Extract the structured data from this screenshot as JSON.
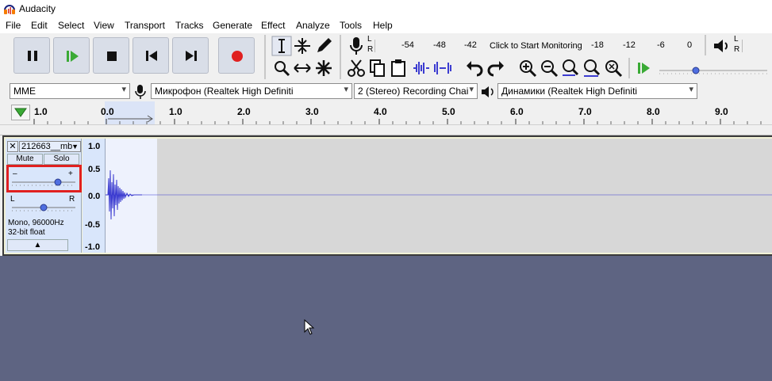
{
  "window": {
    "title": "Audacity"
  },
  "menu": [
    "File",
    "Edit",
    "Select",
    "View",
    "Transport",
    "Tracks",
    "Generate",
    "Effect",
    "Analyze",
    "Tools",
    "Help"
  ],
  "meter": {
    "rec_lr": [
      "L",
      "R"
    ],
    "play_lr": [
      "L",
      "R"
    ],
    "ticks_left": [
      "-54",
      "-48",
      "-42"
    ],
    "monitor_label": "Click to Start Monitoring",
    "ticks_right": [
      "-18",
      "-12",
      "-6",
      "0"
    ]
  },
  "device": {
    "host": "MME",
    "input": "Микрофон (Realtek High Definiti",
    "channels": "2 (Stereo) Recording Chai",
    "output": "Динамики (Realtek High Definiti"
  },
  "ruler": {
    "ticks": [
      "1.0",
      "0.0",
      "1.0",
      "2.0",
      "3.0",
      "4.0",
      "5.0",
      "6.0",
      "7.0",
      "8.0",
      "9.0"
    ]
  },
  "track": {
    "name": "212663__mb",
    "mute": "Mute",
    "solo": "Solo",
    "gain_minus": "–",
    "gain_plus": "+",
    "pan_left": "L",
    "pan_right": "R",
    "info_line1": "Mono, 96000Hz",
    "info_line2": "32-bit float",
    "scale": [
      "1.0",
      "0.5",
      "0.0",
      "-0.5",
      "-1.0"
    ]
  },
  "colors": {
    "accent_red": "#e02020",
    "wave_blue": "#3c3cd0",
    "play_green": "#3aaa35",
    "background": "#5e6482"
  }
}
